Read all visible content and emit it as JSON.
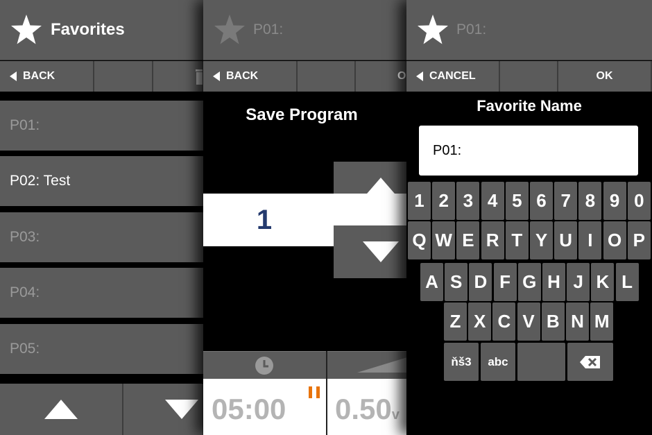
{
  "panel1": {
    "title": "Favorites",
    "back_label": "BACK",
    "items": [
      "P01:",
      "P02: Test",
      "P03:",
      "P04:",
      "P05:"
    ]
  },
  "panel2": {
    "title": "P01:",
    "back_label": "BACK",
    "ok_label": "OK",
    "save_title": "Save Program",
    "program_number": "1",
    "time_value": "05:00",
    "volume_value": "0.50",
    "volume_unit": "v"
  },
  "panel3": {
    "title": "P01:",
    "cancel_label": "CANCEL",
    "ok_label": "OK",
    "favorite_name_label": "Favorite Name",
    "name_value": "P01:",
    "keyboard": {
      "row1": [
        "1",
        "2",
        "3",
        "4",
        "5",
        "6",
        "7",
        "8",
        "9",
        "0"
      ],
      "row2": [
        "Q",
        "W",
        "E",
        "R",
        "T",
        "Y",
        "U",
        "I",
        "O",
        "P"
      ],
      "row3": [
        "A",
        "S",
        "D",
        "F",
        "G",
        "H",
        "J",
        "K",
        "L"
      ],
      "row4": [
        "Z",
        "X",
        "C",
        "V",
        "B",
        "N",
        "M"
      ],
      "special": {
        "symbols": "ňš3",
        "lowercase": "abc"
      }
    }
  },
  "colors": {
    "panel_gray": "#5b5b5b",
    "bar_gray": "#3d3d3d",
    "number_blue": "#243a6e",
    "pause_orange": "#e8740c"
  }
}
